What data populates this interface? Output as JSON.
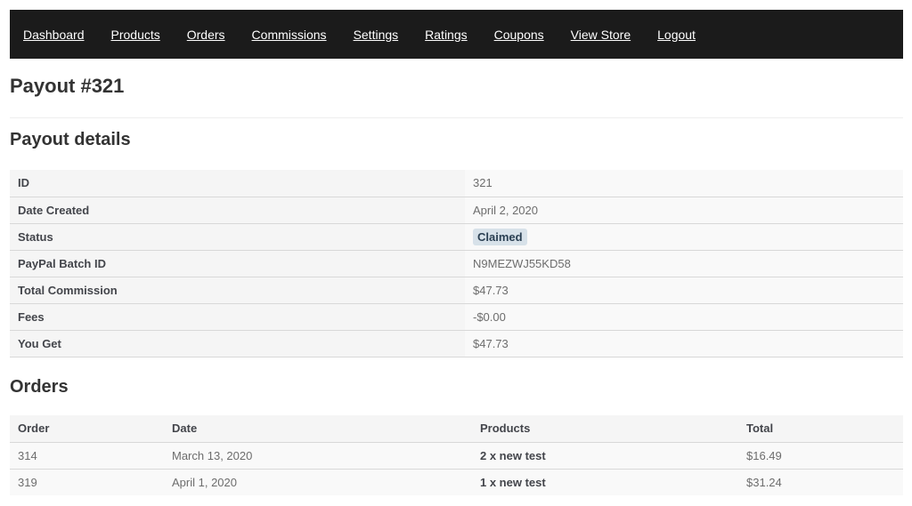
{
  "nav": {
    "items": [
      {
        "label": "Dashboard"
      },
      {
        "label": "Products"
      },
      {
        "label": "Orders"
      },
      {
        "label": "Commissions"
      },
      {
        "label": "Settings"
      },
      {
        "label": "Ratings"
      },
      {
        "label": "Coupons"
      },
      {
        "label": "View Store"
      },
      {
        "label": "Logout"
      }
    ]
  },
  "page": {
    "title": "Payout #321"
  },
  "details": {
    "heading": "Payout details",
    "rows": [
      {
        "label": "ID",
        "value": "321"
      },
      {
        "label": "Date Created",
        "value": "April 2, 2020"
      },
      {
        "label": "Status",
        "value": "Claimed"
      },
      {
        "label": "PayPal Batch ID",
        "value": "N9MEZWJ55KD58"
      },
      {
        "label": "Total Commission",
        "value": "$47.73"
      },
      {
        "label": "Fees",
        "value": "-$0.00"
      },
      {
        "label": "You Get",
        "value": "$47.73"
      }
    ]
  },
  "orders": {
    "heading": "Orders",
    "columns": [
      "Order",
      "Date",
      "Products",
      "Total"
    ],
    "rows": [
      {
        "order": "314",
        "date": "March 13, 2020",
        "products": "2 x new test",
        "total": "$16.49"
      },
      {
        "order": "319",
        "date": "April 1, 2020",
        "products": "1 x new test",
        "total": "$31.24"
      }
    ]
  },
  "colors": {
    "nav_background": "#1b1b1b",
    "status_badge": "#d7e1e9",
    "fee_text": "#b00000"
  }
}
